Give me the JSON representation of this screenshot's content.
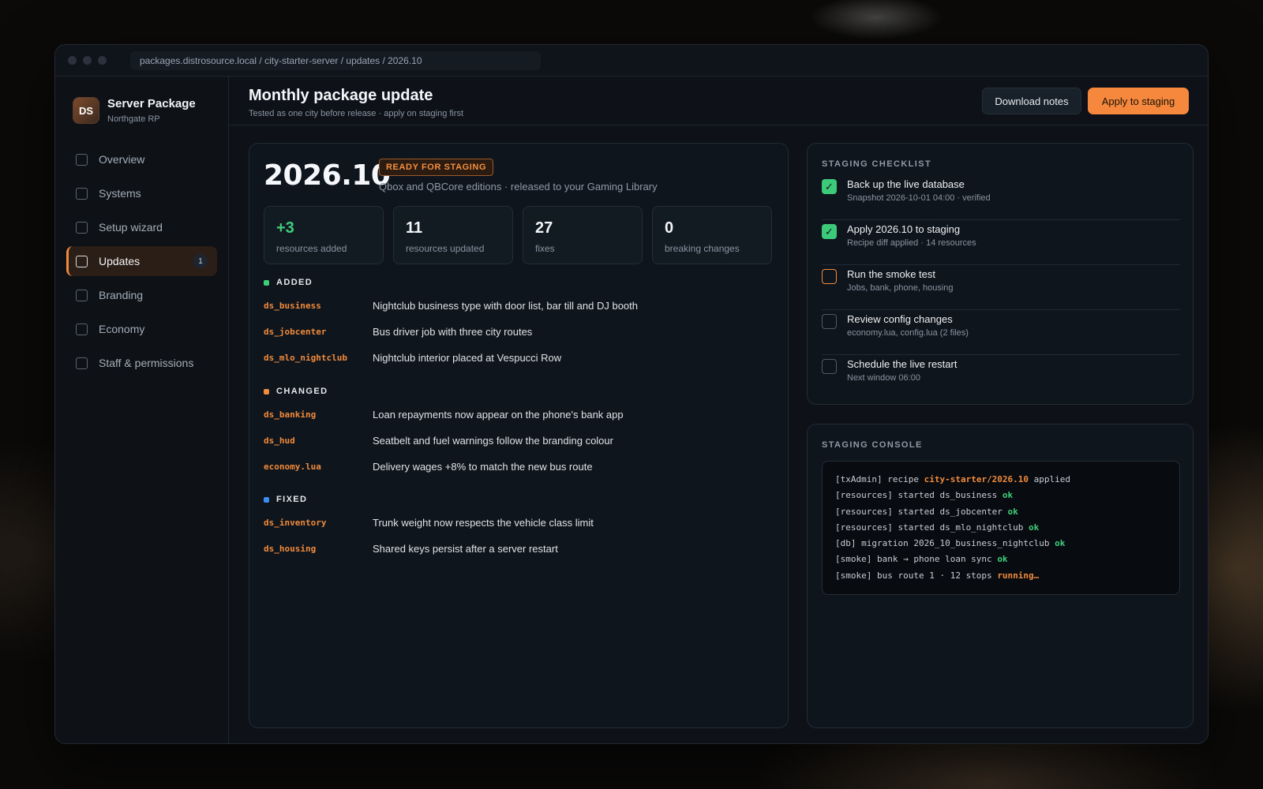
{
  "window": {
    "url": "packages.distrosource.local / city-starter-server / updates / 2026.10"
  },
  "sidebar": {
    "brand_initials": "DS",
    "brand_title": "Server Package",
    "brand_subtitle": "Northgate RP",
    "items": [
      {
        "label": "Overview",
        "active": false
      },
      {
        "label": "Systems",
        "active": false
      },
      {
        "label": "Setup wizard",
        "active": false
      },
      {
        "label": "Updates",
        "active": true,
        "badge": "1"
      },
      {
        "label": "Branding",
        "active": false
      },
      {
        "label": "Economy",
        "active": false
      },
      {
        "label": "Staff & permissions",
        "active": false
      }
    ]
  },
  "header": {
    "title": "Monthly package update",
    "subtitle": "Tested as one city before release · apply on staging first",
    "notes_button": "Download notes",
    "apply_button": "Apply to staging"
  },
  "release": {
    "version": "2026.10",
    "status": "READY FOR STAGING",
    "description": "Qbox and QBCore editions · released to your Gaming Library",
    "stats": [
      {
        "value": "+3",
        "label": "resources added"
      },
      {
        "value": "11",
        "label": "resources updated"
      },
      {
        "value": "27",
        "label": "fixes"
      },
      {
        "value": "0",
        "label": "breaking changes"
      }
    ],
    "sections": [
      {
        "title": "ADDED",
        "color": "#3fcf7a",
        "rows": [
          {
            "resource": "ds_business",
            "desc": "Nightclub business type with door list, bar till and DJ booth"
          },
          {
            "resource": "ds_jobcenter",
            "desc": "Bus driver job with three city routes"
          },
          {
            "resource": "ds_mlo_nightclub",
            "desc": "Nightclub interior placed at Vespucci Row"
          }
        ]
      },
      {
        "title": "CHANGED",
        "color": "#f08a3c",
        "rows": [
          {
            "resource": "ds_banking",
            "desc": "Loan repayments now appear on the phone's bank app"
          },
          {
            "resource": "ds_hud",
            "desc": "Seatbelt and fuel warnings follow the branding colour"
          },
          {
            "resource": "economy.lua",
            "desc": "Delivery wages +8% to match the new bus route"
          }
        ]
      },
      {
        "title": "FIXED",
        "color": "#3b8df0",
        "rows": [
          {
            "resource": "ds_inventory",
            "desc": "Trunk weight now respects the vehicle class limit"
          },
          {
            "resource": "ds_housing",
            "desc": "Shared keys persist after a server restart"
          }
        ]
      }
    ]
  },
  "checklist": {
    "title": "STAGING CHECKLIST",
    "items": [
      {
        "title": "Back up the live database",
        "sub": "Snapshot 2026-10-01 04:00 · verified",
        "state": "done"
      },
      {
        "title": "Apply 2026.10 to staging",
        "sub": "Recipe diff applied · 14 resources",
        "state": "done"
      },
      {
        "title": "Run the smoke test",
        "sub": "Jobs, bank, phone, housing",
        "state": "current"
      },
      {
        "title": "Review config changes",
        "sub": "economy.lua, config.lua (2 files)",
        "state": "todo"
      },
      {
        "title": "Schedule the live restart",
        "sub": "Next window 06:00",
        "state": "todo"
      }
    ]
  },
  "console": {
    "title": "STAGING CONSOLE",
    "lines": [
      {
        "text": "[txAdmin] recipe ",
        "highlight": "city-starter/2026.10",
        "suffix": " applied",
        "tone": "hl"
      },
      {
        "text": "[resources] started ds_business ",
        "highlight": "ok",
        "suffix": "",
        "tone": "ok"
      },
      {
        "text": "[resources] started ds_jobcenter ",
        "highlight": "ok",
        "suffix": "",
        "tone": "ok"
      },
      {
        "text": "[resources] started ds_mlo_nightclub ",
        "highlight": "ok",
        "suffix": "",
        "tone": "ok"
      },
      {
        "text": "[db] migration 2026_10_business_nightclub ",
        "highlight": "ok",
        "suffix": "",
        "tone": "ok"
      },
      {
        "text": "[smoke] bank → phone loan sync ",
        "highlight": "ok",
        "suffix": "",
        "tone": "ok"
      },
      {
        "text": "[smoke] bus route 1 · 12 stops ",
        "highlight": "running…",
        "suffix": "",
        "tone": "hl"
      }
    ]
  }
}
